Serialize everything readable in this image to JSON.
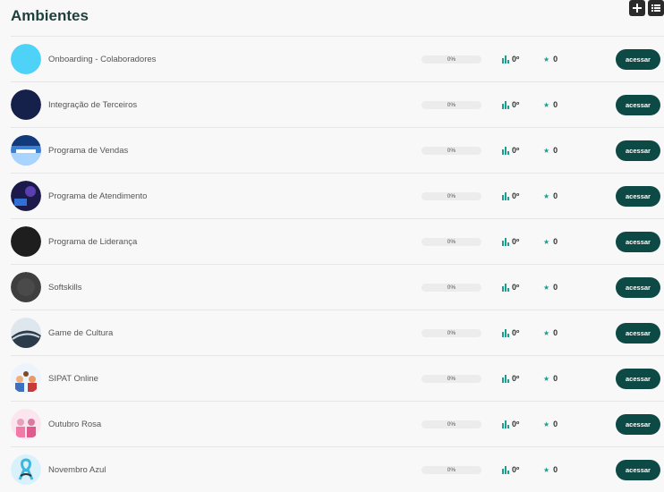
{
  "header": {
    "title": "Ambientes",
    "add_icon": "plus-icon",
    "list_icon": "list-icon"
  },
  "colors": {
    "accent": "#1a9e8f",
    "button": "#0e4a45",
    "title": "#1f3f3c"
  },
  "rows": [
    {
      "name": "Onboarding - Colaboradores",
      "progress": "0%",
      "level": "0º",
      "stars": "0",
      "action": "acessar"
    },
    {
      "name": "Integração de Terceiros",
      "progress": "0%",
      "level": "0º",
      "stars": "0",
      "action": "acessar"
    },
    {
      "name": "Programa de Vendas",
      "progress": "0%",
      "level": "0º",
      "stars": "0",
      "action": "acessar"
    },
    {
      "name": "Programa de Atendimento",
      "progress": "0%",
      "level": "0º",
      "stars": "0",
      "action": "acessar"
    },
    {
      "name": "Programa de Liderança",
      "progress": "0%",
      "level": "0º",
      "stars": "0",
      "action": "acessar"
    },
    {
      "name": "Softskills",
      "progress": "0%",
      "level": "0º",
      "stars": "0",
      "action": "acessar"
    },
    {
      "name": "Game de Cultura",
      "progress": "0%",
      "level": "0º",
      "stars": "0",
      "action": "acessar"
    },
    {
      "name": "SIPAT Online",
      "progress": "0%",
      "level": "0º",
      "stars": "0",
      "action": "acessar"
    },
    {
      "name": "Outubro Rosa",
      "progress": "0%",
      "level": "0º",
      "stars": "0",
      "action": "acessar"
    },
    {
      "name": "Novembro Azul",
      "progress": "0%",
      "level": "0º",
      "stars": "0",
      "action": "acessar"
    }
  ]
}
